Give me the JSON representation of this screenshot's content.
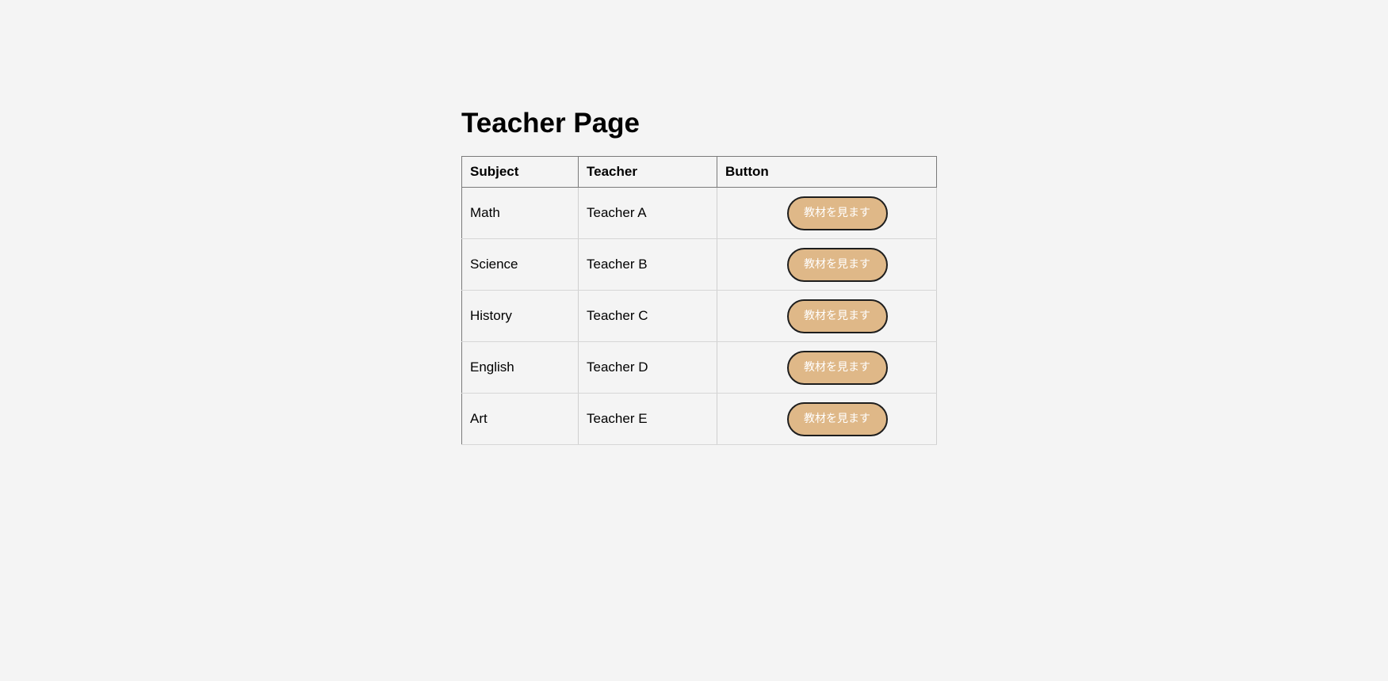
{
  "page": {
    "title": "Teacher Page"
  },
  "table": {
    "headers": [
      "Subject",
      "Teacher",
      "Button"
    ],
    "rows": [
      {
        "subject": "Math",
        "teacher": "Teacher A",
        "button_label": "教材を見ます"
      },
      {
        "subject": "Science",
        "teacher": "Teacher B",
        "button_label": "教材を見ます"
      },
      {
        "subject": "History",
        "teacher": "Teacher C",
        "button_label": "教材を見ます"
      },
      {
        "subject": "English",
        "teacher": "Teacher D",
        "button_label": "教材を見ます"
      },
      {
        "subject": "Art",
        "teacher": "Teacher E",
        "button_label": "教材を見ます"
      }
    ]
  },
  "colors": {
    "background": "#f4f4f4",
    "button_fill": "#dfb888",
    "button_border": "#1e1e1e",
    "button_text": "#ffffff"
  }
}
